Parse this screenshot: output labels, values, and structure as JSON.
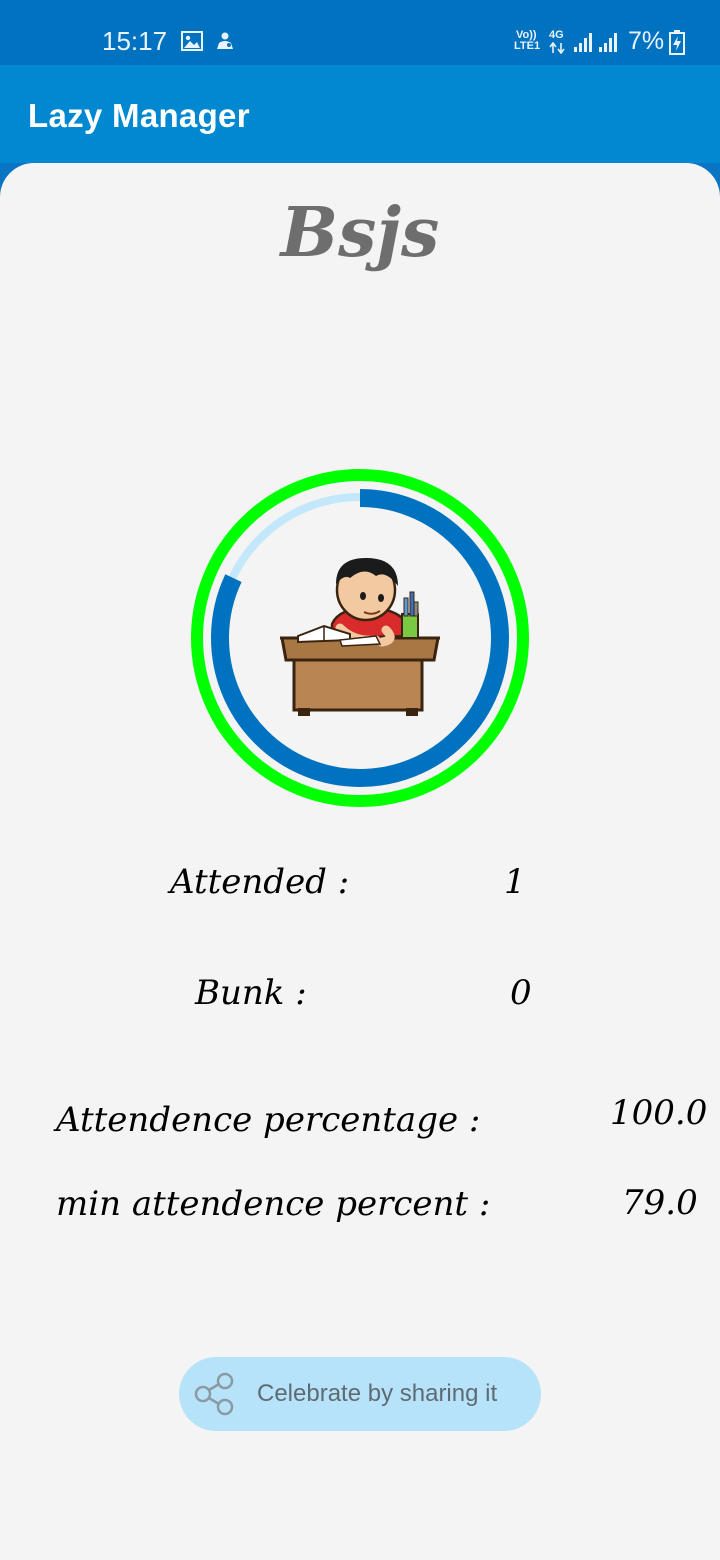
{
  "status_bar": {
    "time": "15:17",
    "network_top": "Vo))",
    "network_bottom": "LTE1",
    "network_4g": "4G",
    "battery": "7%",
    "icons": [
      "gallery-icon",
      "notification-icon",
      "signal-icon",
      "battery-charging-icon"
    ]
  },
  "app_bar": {
    "title": "Lazy Manager"
  },
  "subject": {
    "name": "Bsjs"
  },
  "progress": {
    "attendance_fraction": 0.82,
    "outer_ring_color": "#00ff00",
    "progress_color": "#0072bf",
    "track_color": "#c3e8fb",
    "illustration": "student-studying-illustration"
  },
  "stats": {
    "attended_label": "Attended :",
    "attended_value": "1",
    "bunk_label": "Bunk :",
    "bunk_value": "0",
    "percentage_label": "Attendence percentage :",
    "percentage_value": "100.0",
    "min_label": "min attendence percent :",
    "min_value": "79.0"
  },
  "share": {
    "label": "Celebrate by sharing it",
    "icon": "share-icon"
  }
}
